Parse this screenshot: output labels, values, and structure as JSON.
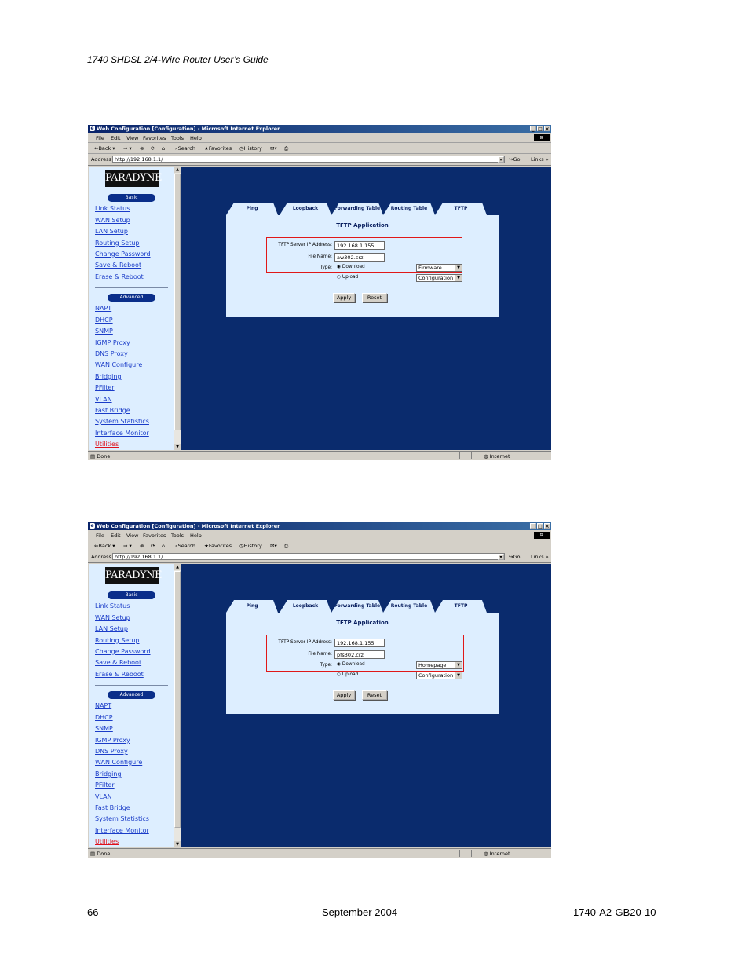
{
  "document": {
    "header": "1740 SHDSL 2/4-Wire Router User’s Guide",
    "page_number": "66",
    "date": "September 2004",
    "doc_id": "1740-A2-GB20-10"
  },
  "browser": {
    "title": "Web Configuration [Configuration] - Microsoft Internet Explorer",
    "menu": [
      "File",
      "Edit",
      "View",
      "Favorites",
      "Tools",
      "Help"
    ],
    "toolbar": {
      "back": "Back",
      "search": "Search",
      "favorites": "Favorites",
      "history": "History"
    },
    "address_label": "Address",
    "address_value": "http://192.168.1.1/",
    "go_label": "Go",
    "links_label": "Links",
    "status_text": "Done",
    "zone_text": "Internet"
  },
  "sidebar": {
    "brand": "PARADYNE",
    "basic_label": "Basic",
    "basic_links": [
      "Link Status",
      "WAN Setup",
      "LAN Setup",
      "Routing Setup",
      "Change Password",
      "Save & Reboot",
      "Erase & Reboot"
    ],
    "advanced_label": "Advanced",
    "advanced_links": [
      "NAPT",
      "DHCP",
      "SNMP",
      "IGMP Proxy",
      "DNS Proxy",
      "WAN Configure",
      "Bridging",
      "PFilter",
      "VLAN",
      "Fast Bridge",
      "System Statistics",
      "Interface Monitor",
      "Utilities"
    ]
  },
  "tabs": [
    "Ping",
    "Loopback",
    "Forwarding Table",
    "Routing Table",
    "TFTP"
  ],
  "tftp": {
    "title": "TFTP Application",
    "server_label": "TFTP Server IP Address:",
    "file_label": "File Name:",
    "type_label": "Type:",
    "download_label": "Download",
    "upload_label": "Upload",
    "apply_label": "Apply",
    "reset_label": "Reset",
    "download_option_2": "Configuration"
  },
  "screenshots": [
    {
      "server_ip": "192.168.1.155",
      "file_name": "aw302.crz",
      "download_type": "Firmware"
    },
    {
      "server_ip": "192.168.1.155",
      "file_name": "pfs302.crz",
      "download_type": "Homepage"
    }
  ]
}
